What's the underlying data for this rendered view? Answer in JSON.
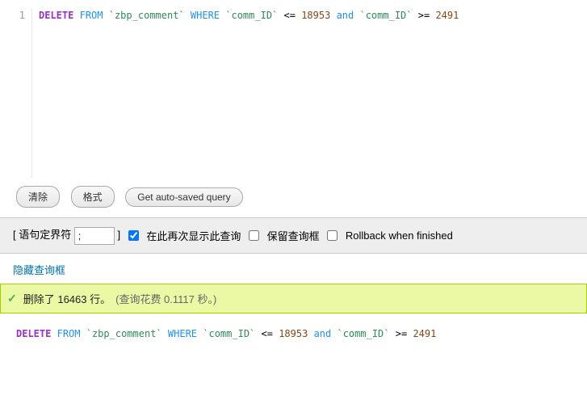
{
  "editor": {
    "line_no": "1",
    "sql": {
      "delete": "DELETE",
      "from": "FROM",
      "table": "`zbp_comment`",
      "where": "WHERE",
      "col1": "`comm_ID`",
      "op1": "<=",
      "val1": "18953",
      "and": "and",
      "col2": "`comm_ID`",
      "op2": ">=",
      "val2": "2491"
    }
  },
  "buttons": {
    "clear": "清除",
    "format": "格式",
    "get_autosaved": "Get auto-saved query"
  },
  "delimiter": {
    "prefix": "[ 语句定界符",
    "value": ";",
    "suffix": "]",
    "retain_label": "在此再次显示此查询",
    "retain_checked": true,
    "keep_label": "保留查询框",
    "keep_checked": false,
    "rollback_label": "Rollback when finished",
    "rollback_checked": false
  },
  "links": {
    "hide_query_box": "隐藏查询框"
  },
  "result": {
    "main": "删除了 16463 行。",
    "sub": "(查询花费 0.1117 秒。)"
  },
  "echo": {
    "delete": "DELETE",
    "from": "FROM",
    "table": "`zbp_comment`",
    "where": "WHERE",
    "col1": "`comm_ID`",
    "op1": "<=",
    "val1": "18953",
    "and": "and",
    "col2": "`comm_ID`",
    "op2": ">=",
    "val2": "2491"
  }
}
